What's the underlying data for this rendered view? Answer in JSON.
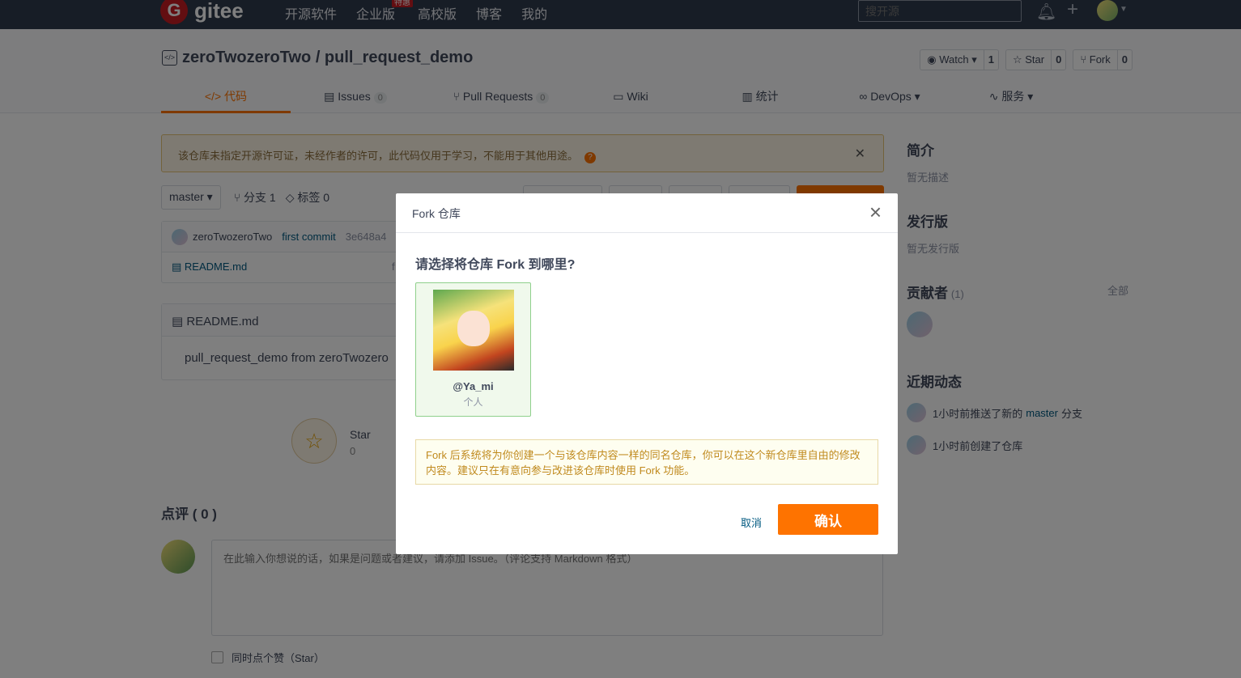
{
  "topnav": {
    "logo_text": "gitee",
    "logo_letter": "G",
    "items": [
      "开源软件",
      "企业版",
      "高校版",
      "博客",
      "我的"
    ],
    "enterprise_badge": "特惠",
    "search_placeholder": "搜开源"
  },
  "repo": {
    "icon_glyph": "</>",
    "title": "zeroTwozeroTwo / pull_request_demo",
    "watch_label": "Watch ▾",
    "watch_count": "1",
    "star_label": "☆ Star",
    "star_count": "0",
    "fork_label": "Fork",
    "fork_count": "0"
  },
  "tabs": [
    {
      "label": "</> 代码"
    },
    {
      "label": "Issues",
      "count": "0"
    },
    {
      "label": "Pull Requests",
      "count": "0"
    },
    {
      "label": "Wiki"
    },
    {
      "label": "统计"
    },
    {
      "label": "DevOps ▾"
    },
    {
      "label": "服务 ▾"
    }
  ],
  "warning": {
    "text": "该仓库未指定开源许可证，未经作者的许可，此代码仅用于学习，不能用于其他用途。",
    "help_glyph": "?",
    "close_glyph": "✕"
  },
  "branch": {
    "selected": "master ▾",
    "branches": "分支 1",
    "tags": "标签 0"
  },
  "commit": {
    "author": "zeroTwozeroTwo",
    "message": "first commit",
    "hash": "3e648a4"
  },
  "files": [
    {
      "name": "README.md",
      "msg": "f"
    }
  ],
  "readme": {
    "title": "README.md",
    "body": "pull_request_demo from zeroTwozero"
  },
  "star_panel": {
    "label": "Star",
    "count": "0"
  },
  "review": {
    "title": "点评 ( 0 )",
    "placeholder": "在此输入你想说的话，如果是问题或者建议，请添加 Issue。（评论支持 Markdown 格式）",
    "star_checkbox_label": "同时点个赞（Star）"
  },
  "sidebar": {
    "intro_title": "简介",
    "intro_text": "暂无描述",
    "release_title": "发行版",
    "release_text": "暂无发行版",
    "contrib_title": "贡献者",
    "contrib_count": "(1)",
    "contrib_all": "全部",
    "activity_title": "近期动态",
    "activities": [
      {
        "prefix": "1小时前推送了新的",
        "branch": "master",
        "suffix": "分支"
      },
      {
        "prefix": "1小时前创建了仓库",
        "branch": "",
        "suffix": ""
      }
    ]
  },
  "modal": {
    "title": "Fork 仓库",
    "close_glyph": "×",
    "question": "请选择将仓库 Fork 到哪里?",
    "namespace_name": "@Ya_mi",
    "namespace_type": "个人",
    "notice": "Fork 后系统将为你创建一个与该仓库内容一样的同名仓库，你可以在这个新仓库里自由的修改内容。建议只在有意向参与改进该仓库时使用 Fork 功能。",
    "cancel_label": "取消",
    "confirm_label": "确认"
  },
  "colors": {
    "brand_orange": "#fe7300",
    "nav_bg": "#2f3a4c",
    "gitee_red": "#c71d23"
  }
}
